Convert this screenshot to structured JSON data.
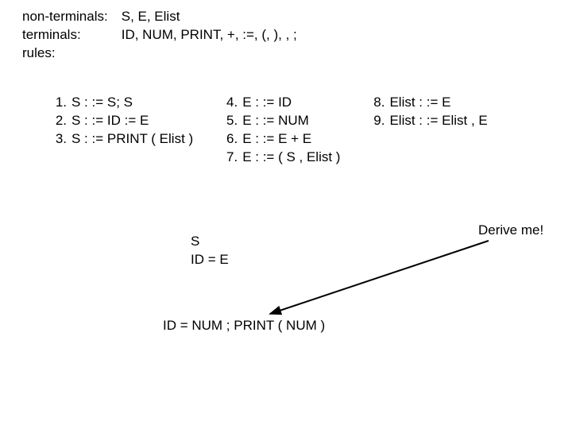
{
  "defs": {
    "nonterminals_label": "non-terminals:",
    "nonterminals_value": "S, E, Elist",
    "terminals_label": "terminals:",
    "terminals_value": "ID, NUM, PRINT, +, :=, (, ), , ;",
    "rules_label": "rules:"
  },
  "rules": {
    "col1": [
      {
        "n": "1.",
        "text": "S : := S; S"
      },
      {
        "n": "2.",
        "text": "S : := ID := E"
      },
      {
        "n": "3.",
        "text": "S : := PRINT ( Elist )"
      }
    ],
    "col2": [
      {
        "n": "4.",
        "text": "E : := ID"
      },
      {
        "n": "5.",
        "text": "E : := NUM"
      },
      {
        "n": "6.",
        "text": "E : := E + E"
      },
      {
        "n": "7.",
        "text": "E : := ( S , Elist )"
      }
    ],
    "col3": [
      {
        "n": "8.",
        "text": "Elist : := E"
      },
      {
        "n": "9.",
        "text": "Elist : := Elist , E"
      }
    ]
  },
  "derivation": {
    "line1": "S",
    "line2": "ID = E"
  },
  "final": "ID = NUM ; PRINT ( NUM )",
  "callout": "Derive me!"
}
